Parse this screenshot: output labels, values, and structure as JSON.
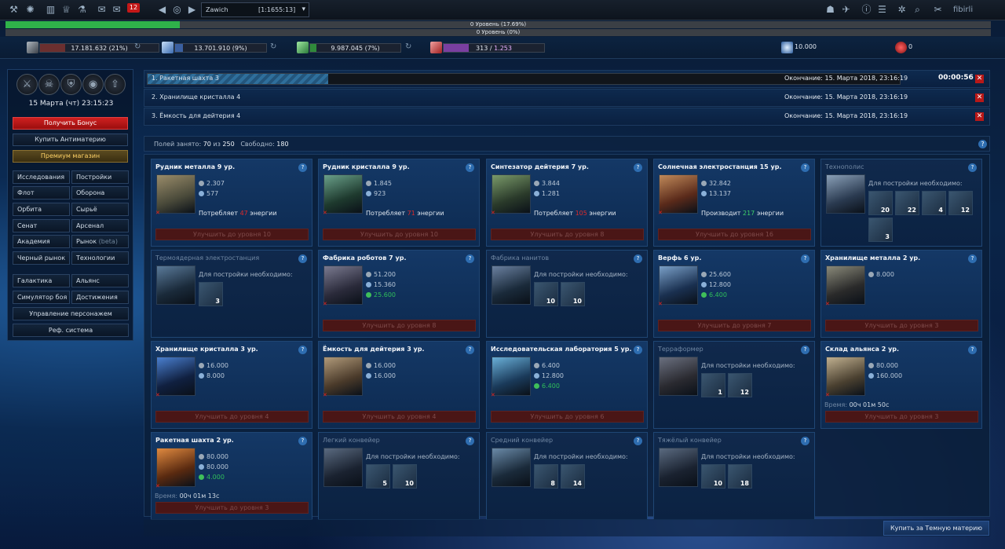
{
  "topbar": {
    "message_count": "12",
    "planet": {
      "name": "Zawich",
      "coords": "[1:1655:13]"
    },
    "username": "fibirli",
    "icons_left": [
      "wrench-icon",
      "galaxy-icon",
      "chart-icon",
      "trophy-icon",
      "flask-icon",
      "chat-icon",
      "messages-icon"
    ],
    "icons_right": [
      "alliance-icon",
      "fleet-icon",
      "info-icon",
      "notes-icon",
      "settings-icon",
      "search-icon",
      "tools-icon"
    ]
  },
  "levels": {
    "primary": "0 Уровень (17.69%)",
    "primary_fraction": 0.1769,
    "secondary": "0 Уровень (0%)",
    "secondary_fraction": 0
  },
  "resources": {
    "metal": {
      "value": "17.181.632 (21%)",
      "fraction": 0.21,
      "color": "#6b2f2f"
    },
    "crystal": {
      "value": "13.701.910 (9%)",
      "fraction": 0.09,
      "color": "#3a5fa0"
    },
    "deuterium": {
      "value": "9.987.045 (7%)",
      "fraction": 0.07,
      "color": "#2f8a3a"
    },
    "energy": {
      "value": "313",
      "max": "1.253",
      "fraction": 0.25,
      "color": "#7a3fa0"
    },
    "dark_matter": "10.000",
    "antimatter": "0"
  },
  "sidebar": {
    "datetime": "15 Марта (чт) 23:15:23",
    "officers": [
      "sword-icon",
      "skull-icon",
      "shield-icon",
      "eye-icon",
      "rocket-icon"
    ],
    "bonus": "Получить Бонус",
    "antimatter": "Купить Антиматерию",
    "premium": "Премиум магазин",
    "nav": {
      "research": "Исследования",
      "buildings": "Постройки",
      "fleet": "Флот",
      "defense": "Оборона",
      "orbit": "Орбита",
      "raw": "Сырьё",
      "senate": "Сенат",
      "arsenal": "Арсенал",
      "academy": "Академия",
      "market": "Рынок",
      "market_beta": "(beta)",
      "black_market": "Черный рынок",
      "technologies": "Технологии",
      "galaxy": "Галактика",
      "alliance": "Альянс",
      "battle_sim": "Симулятор боя",
      "achievements": "Достижения",
      "character": "Управление персонажем",
      "referral": "Реф. система"
    }
  },
  "queue": [
    {
      "name": "1. Ракетная шахта 3",
      "end": "Окончание: 15. Марта 2018, 23:16:19",
      "timer": "00:00:56",
      "progress": 0.24
    },
    {
      "name": "2. Хранилище кристалла 4",
      "end": "Окончание: 15. Марта 2018, 23:16:19"
    },
    {
      "name": "3. Ёмкость для дейтерия 4",
      "end": "Окончание: 15. Марта 2018, 23:16:19"
    }
  ],
  "fields": {
    "label_used": "Полей занято:",
    "used": "70",
    "of": "из",
    "total": "250",
    "label_free": "Свободно:",
    "free": "180"
  },
  "buildings": [
    {
      "title": "Рудник металла 9 ур.",
      "metal": "2.307",
      "crystal": "577",
      "energy_label": "Потребляет",
      "energy": "47",
      "energy_unit": "энергии",
      "upgrade": "Улучшить до уровня 10",
      "img": [
        "#4a4a3a",
        "#9a8c6a"
      ]
    },
    {
      "title": "Рудник кристалла 9 ур.",
      "metal": "1.845",
      "crystal": "923",
      "energy_label": "Потребляет",
      "energy": "71",
      "energy_unit": "энергии",
      "upgrade": "Улучшить до уровня 10",
      "img": [
        "#1e3a2e",
        "#6aa08a"
      ]
    },
    {
      "title": "Синтезатор дейтерия 7 ур.",
      "metal": "3.844",
      "crystal": "1.281",
      "energy_label": "Потребляет",
      "energy": "105",
      "energy_unit": "энергии",
      "upgrade": "Улучшить до уровня 8",
      "img": [
        "#2a3a2a",
        "#7a9a6a"
      ]
    },
    {
      "title": "Солнечная электростанция 15 ур.",
      "metal": "32.842",
      "crystal": "13.137",
      "energy_label": "Производит",
      "energy": "217",
      "energy_unit": "энергии",
      "upgrade": "Улучшить до уровня 16",
      "img": [
        "#5a2a1a",
        "#c08a5a"
      ]
    },
    {
      "title": "Технополис",
      "req_label": "Для постройки необходимо:",
      "reqs": [
        "20",
        "22",
        "4",
        "12",
        "3"
      ],
      "img": [
        "#2a3a50",
        "#8aa0b8"
      ]
    },
    {
      "title": "Термоядерная электростанция",
      "req_label": "Для постройки необходимо:",
      "reqs": [
        "3"
      ],
      "img": [
        "#1a2a3a",
        "#5a7a9a"
      ]
    },
    {
      "title": "Фабрика роботов 7 ур.",
      "metal": "51.200",
      "crystal": "15.360",
      "deut": "25.600",
      "upgrade": "Улучшить до уровня 8",
      "img": [
        "#2a2a3a",
        "#7a7a90"
      ]
    },
    {
      "title": "Фабрика нанитов",
      "req_label": "Для постройки необходимо:",
      "reqs": [
        "10",
        "10"
      ],
      "img": [
        "#1a2a3a",
        "#6a80a0"
      ]
    },
    {
      "title": "Верфь 6 ур.",
      "metal": "25.600",
      "crystal": "12.800",
      "deut": "6.400",
      "upgrade": "Улучшить до уровня 7",
      "img": [
        "#1a3050",
        "#7aa0c8"
      ]
    },
    {
      "title": "Хранилище металла 2 ур.",
      "metal": "8.000",
      "upgrade": "Улучшить до уровня 3",
      "img": [
        "#2a2a2a",
        "#8a8a7a"
      ]
    },
    {
      "title": "Хранилище кристалла 3 ур.",
      "metal": "16.000",
      "crystal": "8.000",
      "upgrade": "Улучшить до уровня 4",
      "img": [
        "#102040",
        "#4a80d0"
      ]
    },
    {
      "title": "Ёмкость для дейтерия 3 ур.",
      "metal": "16.000",
      "crystal": "16.000",
      "upgrade": "Улучшить до уровня 4",
      "img": [
        "#4a3a2a",
        "#b09a7a"
      ]
    },
    {
      "title": "Исследовательская лаборатория 5 ур.",
      "metal": "6.400",
      "crystal": "12.800",
      "deut": "6.400",
      "upgrade": "Улучшить до уровня 6",
      "img": [
        "#1a3a5a",
        "#6ab0d8"
      ]
    },
    {
      "title": "Терраформер",
      "req_label": "Для постройки необходимо:",
      "reqs": [
        "1",
        "12"
      ],
      "img": [
        "#2a2a30",
        "#6a7080"
      ]
    },
    {
      "title": "Склад альянса 2 ур.",
      "metal": "80.000",
      "crystal": "160.000",
      "time_label": "Время:",
      "time": "00ч 01м 50с",
      "upgrade": "Улучшить до уровня 3",
      "img": [
        "#4a4030",
        "#c0b090"
      ]
    },
    {
      "title": "Ракетная шахта 2 ур.",
      "metal": "80.000",
      "crystal": "80.000",
      "deut": "4.000",
      "time_label": "Время:",
      "time": "00ч 01м 13с",
      "upgrade": "Улучшить до уровня 3",
      "img": [
        "#5a2a10",
        "#e08a40"
      ]
    },
    {
      "title": "Легкий конвейер",
      "req_label": "Для постройки необходимо:",
      "reqs": [
        "5",
        "10"
      ],
      "img": [
        "#1a2230",
        "#5a6a80"
      ]
    },
    {
      "title": "Средний конвейер",
      "req_label": "Для постройки необходимо:",
      "reqs": [
        "8",
        "14"
      ],
      "img": [
        "#1a2a3a",
        "#6a8aa8"
      ]
    },
    {
      "title": "Тяжёлый конвейер",
      "req_label": "Для постройки необходимо:",
      "reqs": [
        "10",
        "18"
      ],
      "img": [
        "#1a2230",
        "#5a6a80"
      ]
    }
  ],
  "buy_dark": "Купить за Темную материю",
  "help_symbol": "?",
  "remove_symbol": "✕"
}
